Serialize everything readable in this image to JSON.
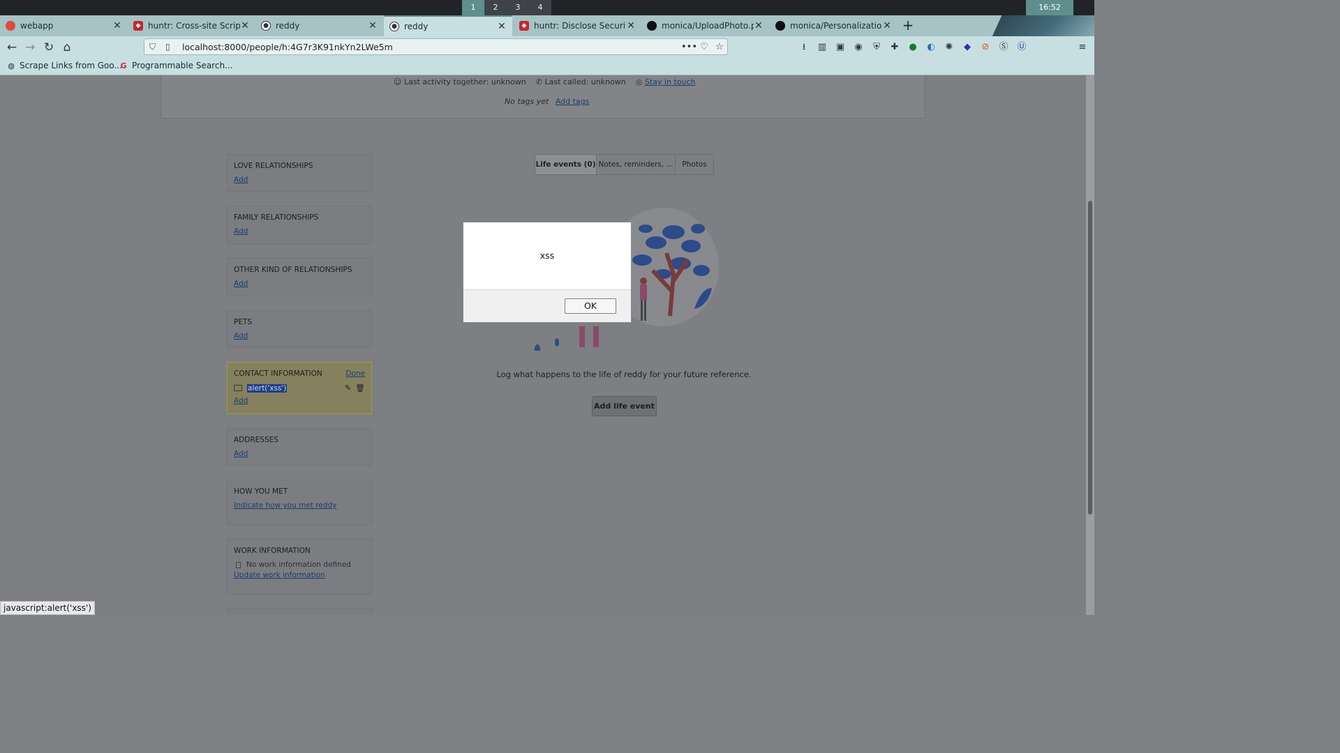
{
  "system": {
    "workspaces": [
      "1",
      "2",
      "3",
      "4"
    ],
    "active_workspace": "1",
    "clock": "16:52"
  },
  "tabs": [
    {
      "label": "webapp",
      "icon": "webapp-favicon"
    },
    {
      "label": "huntr: Cross-site Scriptin",
      "icon": "huntr-favicon"
    },
    {
      "label": "reddy",
      "icon": "monica-favicon"
    },
    {
      "label": "reddy",
      "icon": "monica-favicon",
      "active": true
    },
    {
      "label": "huntr: Disclose Security V",
      "icon": "huntr-favicon"
    },
    {
      "label": "monica/UploadPhoto.php",
      "icon": "github-favicon"
    },
    {
      "label": "monica/PersonalizationC",
      "icon": "github-favicon"
    }
  ],
  "new_tab_label": "+",
  "address_bar": {
    "url": "localhost:8000/people/h:4G7r3K91nkYn2LWe5m"
  },
  "bookmarks": [
    {
      "label": "Scrape Links from Goo...",
      "icon": "globe-icon"
    },
    {
      "label": "Programmable Search...",
      "icon": "google-icon"
    }
  ],
  "header_panel": {
    "last_activity": "Last activity together: unknown",
    "last_called": "Last called: unknown",
    "stay_in_touch": "Stay in touch",
    "no_tags": "No tags yet",
    "add_tags": "Add tags"
  },
  "sidebar": {
    "love": {
      "title": "LOVE RELATIONSHIPS",
      "link": "Add"
    },
    "family": {
      "title": "FAMILY RELATIONSHIPS",
      "link": "Add"
    },
    "other": {
      "title": "OTHER KIND OF RELATIONSHIPS",
      "link": "Add"
    },
    "pets": {
      "title": "PETS",
      "link": "Add"
    },
    "contact": {
      "title": "CONTACT INFORMATION",
      "done": "Done",
      "value": "alert('xss')",
      "link": "Add"
    },
    "addresses": {
      "title": "ADDRESSES",
      "link": "Add"
    },
    "how_met": {
      "title": "HOW YOU MET",
      "link": "Indicate how you met reddy"
    },
    "work": {
      "title": "WORK INFORMATION",
      "none": "No work information defined",
      "link": "Update work information"
    }
  },
  "main": {
    "tabs": [
      "Life events (0)",
      "Notes, reminders, ...",
      "Photos"
    ],
    "empty_message": "Log what happens to the life of reddy for your future reference.",
    "add_button": "Add life event"
  },
  "dialog": {
    "message": "xss",
    "ok": "OK"
  },
  "status_bar": "javascript:alert('xss')",
  "colors": {
    "accent": "#5e8f8c",
    "tab_bar": "#a6c3c6",
    "nav_bar": "#c8dfe2",
    "link": "#1a3d6e",
    "overlay_dim": "#7d7f82"
  }
}
